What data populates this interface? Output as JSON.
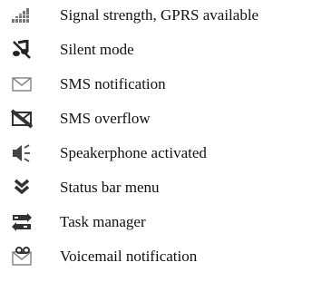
{
  "legend": {
    "items": [
      {
        "icon": "signal-strength-gprs-icon",
        "label": "Signal strength, GPRS available"
      },
      {
        "icon": "silent-mode-icon",
        "label": "Silent mode"
      },
      {
        "icon": "sms-notification-icon",
        "label": "SMS notification"
      },
      {
        "icon": "sms-overflow-icon",
        "label": "SMS overflow"
      },
      {
        "icon": "speakerphone-icon",
        "label": "Speakerphone activated"
      },
      {
        "icon": "status-bar-menu-icon",
        "label": "Status bar menu"
      },
      {
        "icon": "task-manager-icon",
        "label": "Task manager"
      },
      {
        "icon": "voicemail-notification-icon",
        "label": "Voicemail notification"
      }
    ]
  }
}
